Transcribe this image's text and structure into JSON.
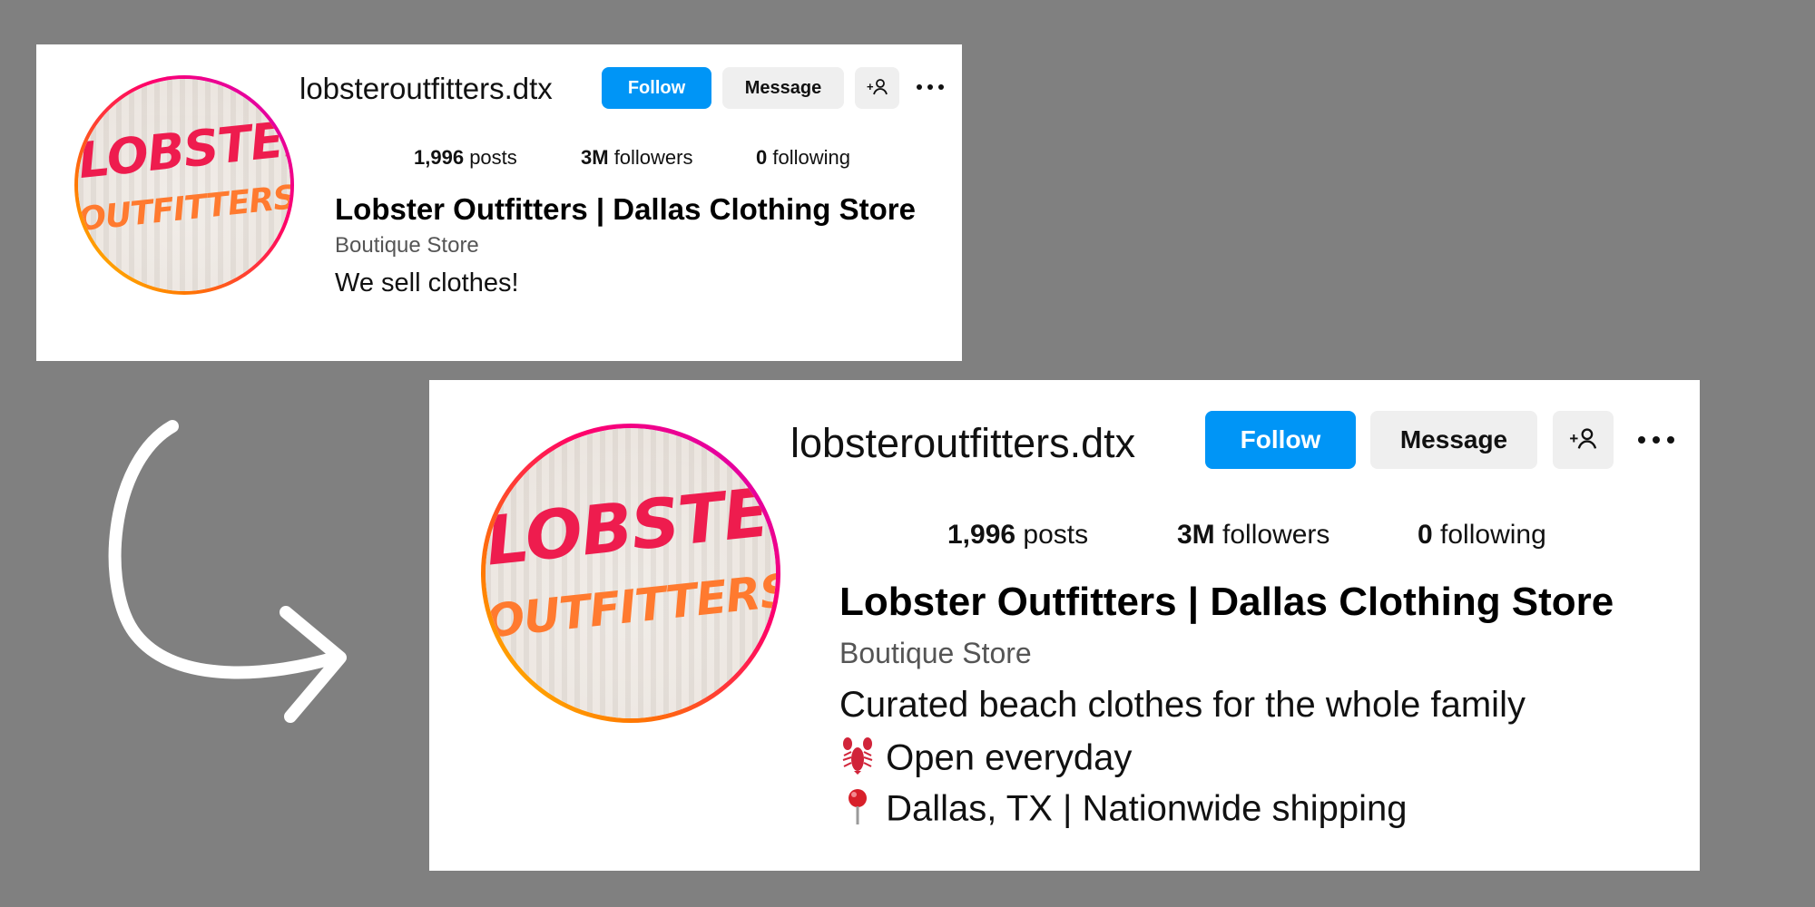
{
  "before": {
    "username": "lobsteroutfitters.dtx",
    "follow_label": "Follow",
    "message_label": "Message",
    "add_user_icon": "person-plus-icon",
    "more_icon": "ellipsis-icon",
    "stats": {
      "posts_value": "1,996",
      "posts_label": "posts",
      "followers_value": "3M",
      "followers_label": "followers",
      "following_value": "0",
      "following_label": "following"
    },
    "display_name": "Lobster Outfitters | Dallas Clothing Store",
    "category": "Boutique Store",
    "bio": "We sell clothes!",
    "avatar_logo": {
      "line1": "LOBSTER",
      "line2": "OUTFITTERS"
    }
  },
  "after": {
    "username": "lobsteroutfitters.dtx",
    "follow_label": "Follow",
    "message_label": "Message",
    "add_user_icon": "person-plus-icon",
    "more_icon": "ellipsis-icon",
    "stats": {
      "posts_value": "1,996",
      "posts_label": "posts",
      "followers_value": "3M",
      "followers_label": "followers",
      "following_value": "0",
      "following_label": "following"
    },
    "display_name": "Lobster Outfitters | Dallas Clothing Store",
    "category": "Boutique Store",
    "bio_lines": [
      {
        "icon": "",
        "text": "Curated beach clothes for the whole family"
      },
      {
        "icon": "lobster-icon",
        "text": "Open everyday"
      },
      {
        "icon": "pin-icon",
        "text": "Dallas, TX | Nationwide shipping"
      }
    ],
    "avatar_logo": {
      "line1": "LOBSTER",
      "line2": "OUTFITTERS"
    }
  },
  "colors": {
    "background": "#808080",
    "follow": "#0095f6",
    "secondary_button": "#efefef",
    "logo_red": "#ee1c4e",
    "logo_orange": "#ff7a2f",
    "arrow": "#ffffff"
  }
}
